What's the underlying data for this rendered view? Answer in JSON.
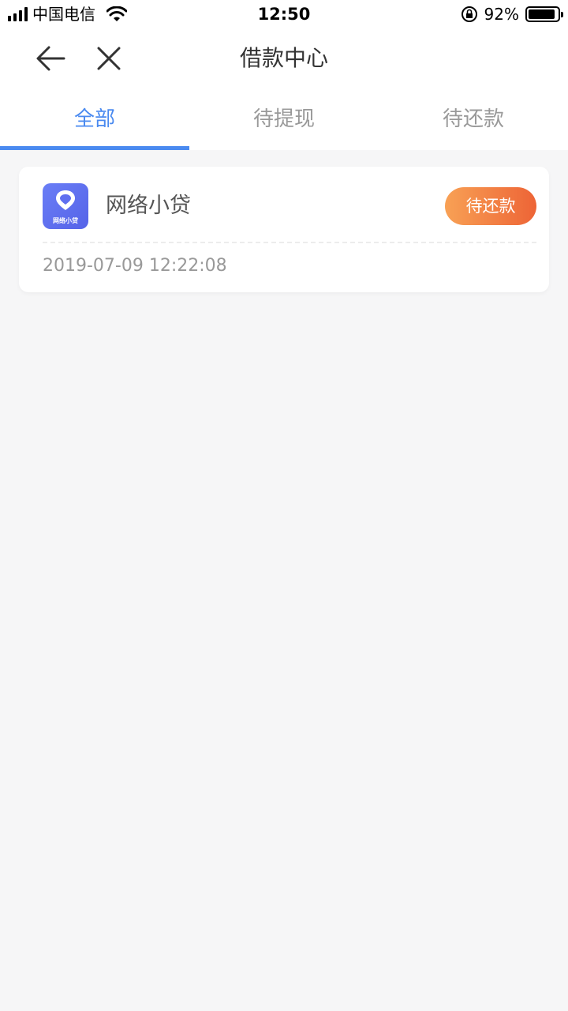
{
  "status_bar": {
    "carrier": "中国电信",
    "time": "12:50",
    "battery": "92%",
    "battery_level": 0.92
  },
  "nav": {
    "title": "借款中心"
  },
  "tabs": [
    {
      "label": "全部",
      "active": true
    },
    {
      "label": "待提现",
      "active": false
    },
    {
      "label": "待还款",
      "active": false
    }
  ],
  "loans": [
    {
      "logo_text": "网络小贷",
      "name": "网络小贷",
      "status": "待还款",
      "date": "2019-07-09 12:22:08"
    }
  ],
  "colors": {
    "accent": "#4a8af0",
    "status_start": "#f8a155",
    "status_end": "#ed6436",
    "logo": "#5f6ff0"
  }
}
